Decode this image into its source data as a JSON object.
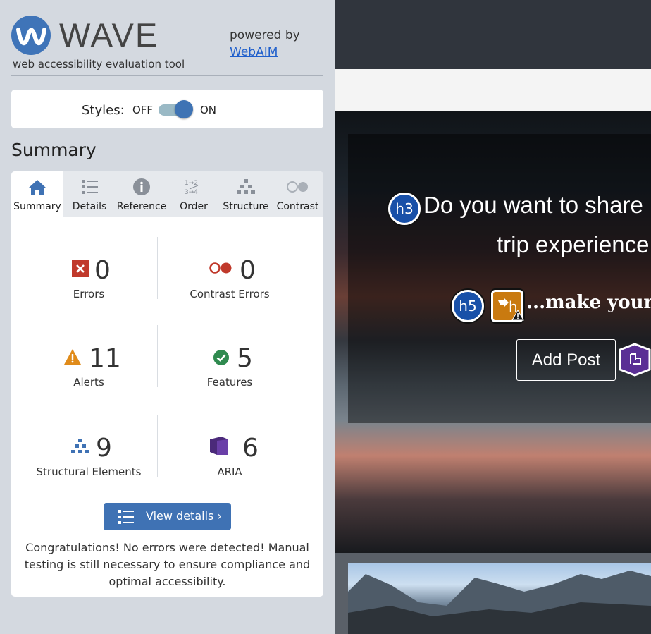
{
  "wave": {
    "title": "WAVE",
    "subtitle": "web accessibility evaluation tool",
    "powered_by": "powered by",
    "webaim_link": "WebAIM"
  },
  "styles_toggle": {
    "label": "Styles:",
    "off": "OFF",
    "on": "ON",
    "state": "on"
  },
  "summary_heading": "Summary",
  "tabs": [
    {
      "label": "Summary",
      "icon": "home-icon",
      "active": true
    },
    {
      "label": "Details",
      "icon": "list-icon",
      "active": false
    },
    {
      "label": "Reference",
      "icon": "info-icon",
      "active": false
    },
    {
      "label": "Order",
      "icon": "order-icon",
      "active": false
    },
    {
      "label": "Structure",
      "icon": "structure-icon",
      "active": false
    },
    {
      "label": "Contrast",
      "icon": "contrast-icon",
      "active": false
    }
  ],
  "stats": {
    "errors": {
      "count": "0",
      "label": "Errors",
      "icon": "error-icon"
    },
    "contrast_errors": {
      "count": "0",
      "label": "Contrast Errors",
      "icon": "contrast-error-icon"
    },
    "alerts": {
      "count": "11",
      "label": "Alerts",
      "icon": "alert-icon"
    },
    "features": {
      "count": "5",
      "label": "Features",
      "icon": "feature-icon"
    },
    "structural": {
      "count": "9",
      "label": "Structural Elements",
      "icon": "structure-icon"
    },
    "aria": {
      "count": "6",
      "label": "ARIA",
      "icon": "aria-icon"
    }
  },
  "view_details": "View details ›",
  "congrats": "Congratulations! No errors were detected! Manual testing is still necessary to ensure compliance and optimal accessibility.",
  "preview": {
    "h3_badge": "h3",
    "title_line1": "Do you want to share",
    "title_line2": "trip experience",
    "h5_badge": "h5",
    "alert_badge_letter": "h",
    "subtitle": "...make your o",
    "add_post": "Add Post"
  },
  "colors": {
    "accent": "#3f72b4",
    "error": "#c0392b",
    "alert": "#e08b1a",
    "feature": "#2f8a4f",
    "aria": "#4b2a7a"
  }
}
